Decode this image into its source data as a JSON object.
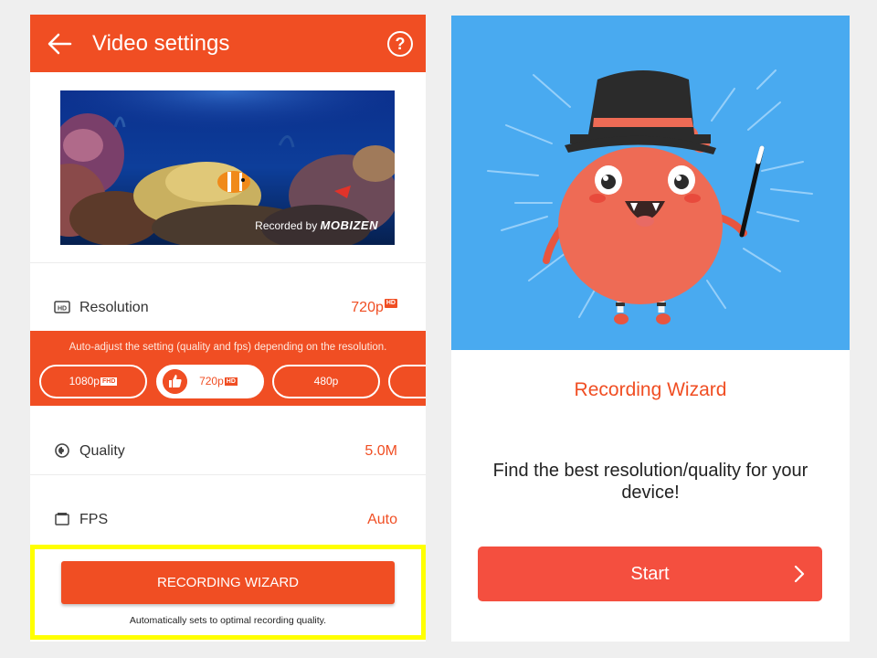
{
  "left_screen": {
    "header": {
      "title": "Video settings",
      "back_icon": "back-arrow-icon",
      "help_icon": "help-icon",
      "help_glyph": "?"
    },
    "preview": {
      "watermark_prefix": "Recorded by",
      "watermark_brand": "MOBIZEN"
    },
    "resolution_row": {
      "label": "Resolution",
      "value": "720p",
      "badge": "HD"
    },
    "auto_adjust": {
      "text": "Auto-adjust the setting (quality and fps) depending on the resolution.",
      "options": [
        {
          "label": "1080p",
          "badge": "FHD",
          "selected": false
        },
        {
          "label": "720p",
          "badge": "HD",
          "selected": true
        },
        {
          "label": "480p",
          "badge": "",
          "selected": false
        }
      ]
    },
    "quality_row": {
      "label": "Quality",
      "value": "5.0M"
    },
    "fps_row": {
      "label": "FPS",
      "value": "Auto"
    },
    "wizard": {
      "button_label": "RECORDING WIZARD",
      "note": "Automatically sets to optimal recording quality."
    }
  },
  "right_screen": {
    "title": "Recording Wizard",
    "description": "Find the best resolution/quality for your device!",
    "start_label": "Start"
  },
  "colors": {
    "accent": "#f04e23",
    "hero_blue": "#49aaf0",
    "highlight": "#ffff00",
    "start_button": "#f44f3f"
  }
}
